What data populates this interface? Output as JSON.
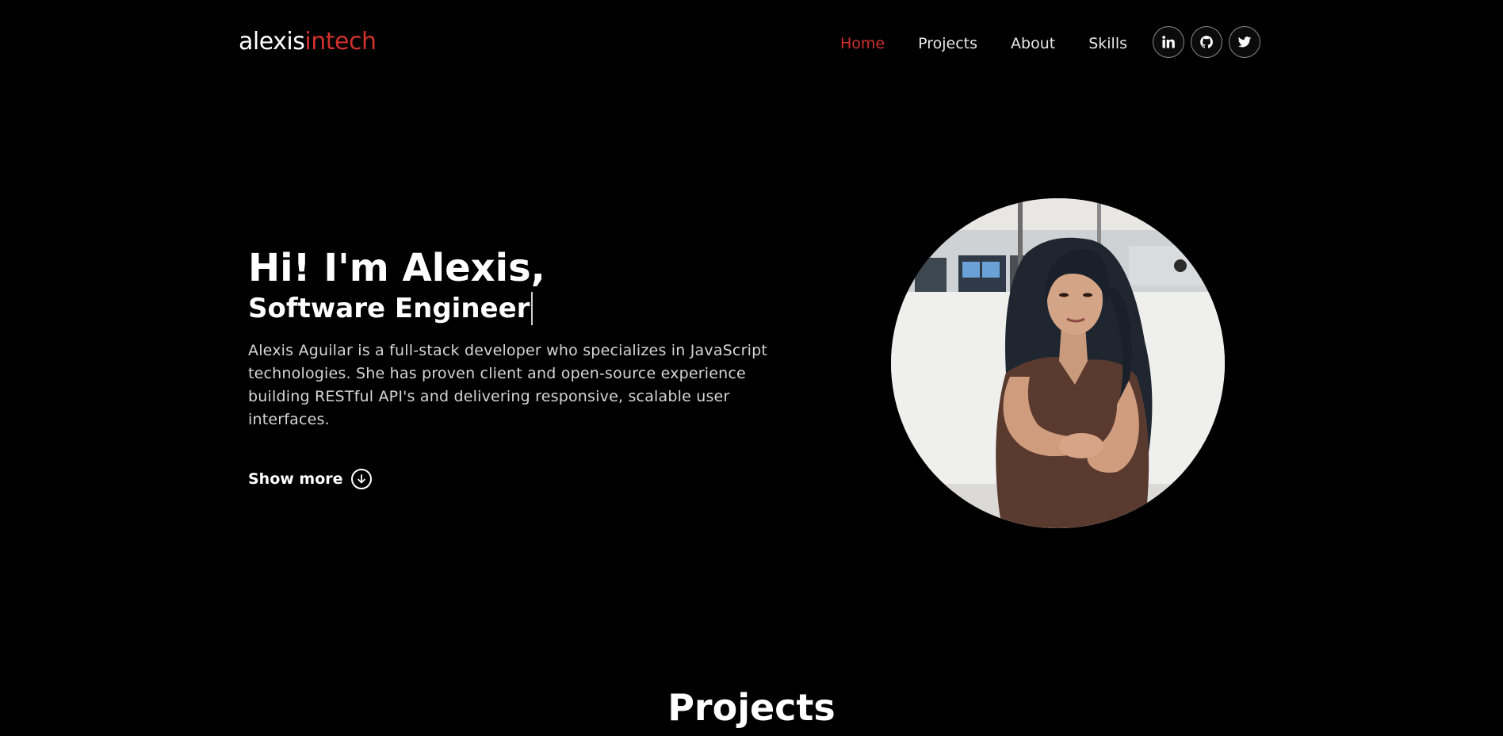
{
  "logo": {
    "part1": "alexis",
    "part2": "intech"
  },
  "nav": {
    "items": [
      {
        "label": "Home",
        "active": true
      },
      {
        "label": "Projects",
        "active": false
      },
      {
        "label": "About",
        "active": false
      },
      {
        "label": "Skills",
        "active": false
      }
    ],
    "social": [
      {
        "name": "linkedin",
        "icon": "linkedin-icon"
      },
      {
        "name": "github",
        "icon": "github-icon"
      },
      {
        "name": "twitter",
        "icon": "twitter-icon"
      }
    ]
  },
  "hero": {
    "title": "Hi! I'm Alexis,",
    "subtitle": "Software Engineer",
    "description": "Alexis Aguilar is a full-stack developer who specializes in JavaScript technologies. She has proven client and open-source experience building RESTful API's and delivering responsive, scalable user interfaces.",
    "show_more": "Show more",
    "show_more_icon": "arrow-down-circle-icon"
  },
  "sections": {
    "projects_heading": "Projects"
  },
  "colors": {
    "background": "#000000",
    "accent": "#d0312d",
    "text": "#ffffff",
    "muted_text": "#d6d6d6"
  }
}
